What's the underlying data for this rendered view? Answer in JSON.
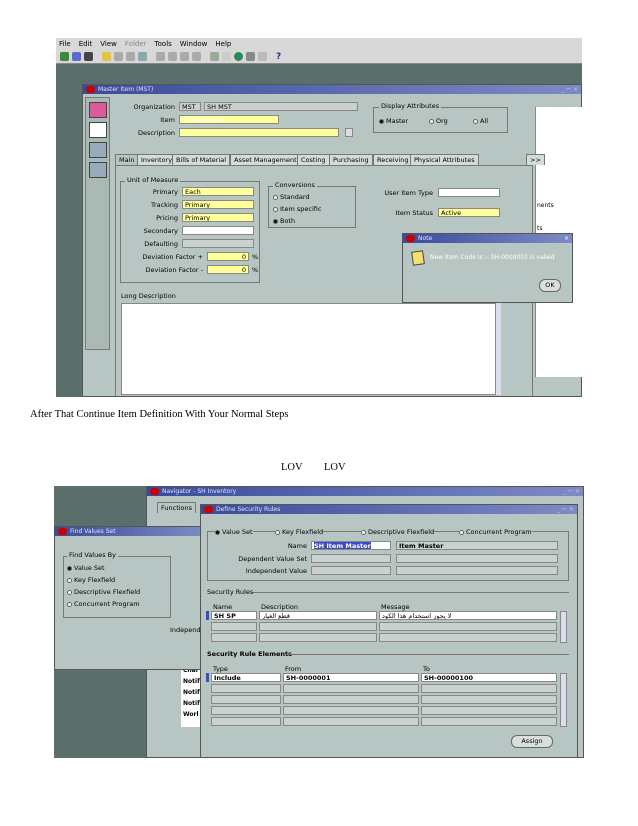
{
  "screen1": {
    "menu": [
      "File",
      "Edit",
      "View",
      "Folder",
      "Tools",
      "Window",
      "Help"
    ],
    "window_title": "Master Item (MST)",
    "organization_label": "Organization",
    "organization_code": "MST",
    "organization_name": "SH MST",
    "item_label": "Item",
    "item_value": "SH-0000002",
    "description_label": "Description",
    "display_attributes_label": "Display Attributes",
    "display_options": [
      "Master",
      "Org",
      "All"
    ],
    "tabs": [
      "Main",
      "Inventory",
      "Bills of Material",
      "Asset Management",
      "Costing",
      "Purchasing",
      "Receiving",
      "Physical Attributes"
    ],
    "tabs_more": ">>",
    "uom_group": "Unit of Measure",
    "uom_rows": [
      {
        "label": "Primary",
        "value": "Each"
      },
      {
        "label": "Tracking",
        "value": "Primary"
      },
      {
        "label": "Pricing",
        "value": "Primary"
      },
      {
        "label": "Secondary",
        "value": ""
      },
      {
        "label": "Defaulting",
        "value": ""
      },
      {
        "label": "Deviation Factor +",
        "value": "0",
        "unit": "%"
      },
      {
        "label": "Deviation Factor -",
        "value": "0",
        "unit": "%"
      }
    ],
    "conversions_group": "Conversions",
    "conversion_options": [
      "Standard",
      "Item specific",
      "Both"
    ],
    "user_item_type_label": "User Item Type",
    "item_status_label": "Item Status",
    "item_status_value": "Active",
    "long_description_label": "Long Description",
    "note_title": "Note",
    "note_message": "New Item Code Is :-  SH-0000002   is valied",
    "ok_label": "OK",
    "right_partial_text": [
      "nents",
      "ts"
    ]
  },
  "caption1": "After That Continue Item Definition With Your Normal Steps",
  "lov_labels": [
    "LOV",
    "LOV"
  ],
  "screen2": {
    "navigator_title": "Navigator - SH Inventory",
    "functions_tab": "Functions",
    "find_values_title": "Find Values Set",
    "find_values_by": "Find Values By",
    "find_options": [
      "Value Set",
      "Key Flexfield",
      "Descriptive Flexfield",
      "Concurrent Program"
    ],
    "independent_partial": "Independ",
    "nav_partial_rows": [
      "Chai",
      "Notif",
      "Notif",
      "Notif",
      "Worl"
    ],
    "dsr_title": "Define Security Rules",
    "dsr_options": [
      "Value Set",
      "Key Flexfield",
      "Descriptive Flexfield",
      "Concurrent Program"
    ],
    "name_label": "Name",
    "name_value": "SH Item Master",
    "name_desc": "Item Master",
    "dependent_label": "Dependent Value Set",
    "independent_label": "Independent Value",
    "security_rules_label": "Security Rules",
    "rule_headers": [
      "Name",
      "Description",
      "Message"
    ],
    "rule_row": {
      "name": "SH SP",
      "description": "قطع الغيار",
      "message": "لا يجوز استخدام هذا الكود"
    },
    "rule_elements_label": "Security Rule Elements",
    "element_headers": [
      "Type",
      "From",
      "To"
    ],
    "element_row": {
      "type": "Include",
      "from": "SH-0000001",
      "to": "SH-00000100"
    },
    "assign_label": "Assign"
  },
  "colors": {
    "form_bg": "#b7c6c2",
    "title_bar": "#3a4b9a",
    "required_yellow": "#ffff9c",
    "desktop": "#5a6e6c"
  }
}
